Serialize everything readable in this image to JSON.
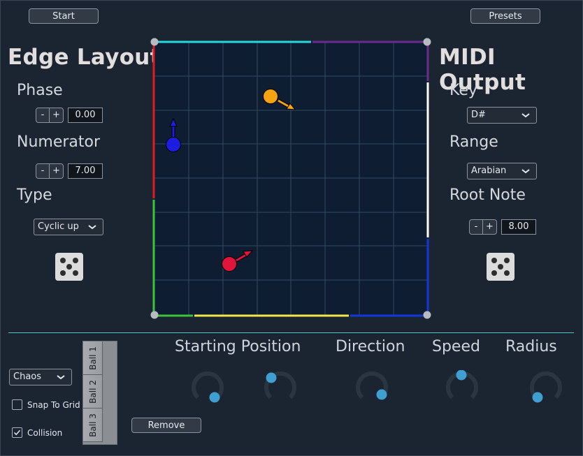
{
  "header": {
    "start_label": "Start",
    "presets_label": "Presets"
  },
  "edge_layout": {
    "title": "Edge Layout",
    "phase_label": "Phase",
    "phase_value": "0.00",
    "numerator_label": "Numerator",
    "numerator_value": "7.00",
    "type_label": "Type",
    "type_value": "Cyclic up",
    "minus": "-",
    "plus": "+"
  },
  "midi_output": {
    "title": "MIDI Output",
    "key_label": "Key",
    "key_value": "D#",
    "range_label": "Range",
    "range_value": "Arabian",
    "root_note_label": "Root Note",
    "root_note_value": "8.00",
    "minus": "-",
    "plus": "+"
  },
  "canvas": {
    "background": "#0f1d33",
    "edge_colors": [
      "#e11b22",
      "#29d6dc",
      "#6a2d8f",
      "#ffffff",
      "#1239d6",
      "#f0e94a",
      "#3bc43b"
    ],
    "balls": [
      {
        "name": "ball-orange",
        "color": "#f5a313",
        "arrow_color": "#f5a313"
      },
      {
        "name": "ball-blue",
        "color": "#1d1de0",
        "arrow_color": "#1d1de0"
      },
      {
        "name": "ball-red",
        "color": "#e0153c",
        "arrow_color": "#e0153c"
      }
    ]
  },
  "bottom": {
    "mode_value": "Chaos",
    "snap_to_grid_label": "Snap To Grid",
    "snap_to_grid_checked": false,
    "collision_label": "Collision",
    "collision_checked": true,
    "ball_tabs": [
      "Ball 1",
      "Ball 2",
      "Ball 3"
    ],
    "remove_label": "Remove",
    "starting_position_label": "Starting Position",
    "direction_label": "Direction",
    "speed_label": "Speed",
    "radius_label": "Radius",
    "knob_track_color": "#2b3542",
    "knob_thumb_color": "#3f9fd1"
  }
}
